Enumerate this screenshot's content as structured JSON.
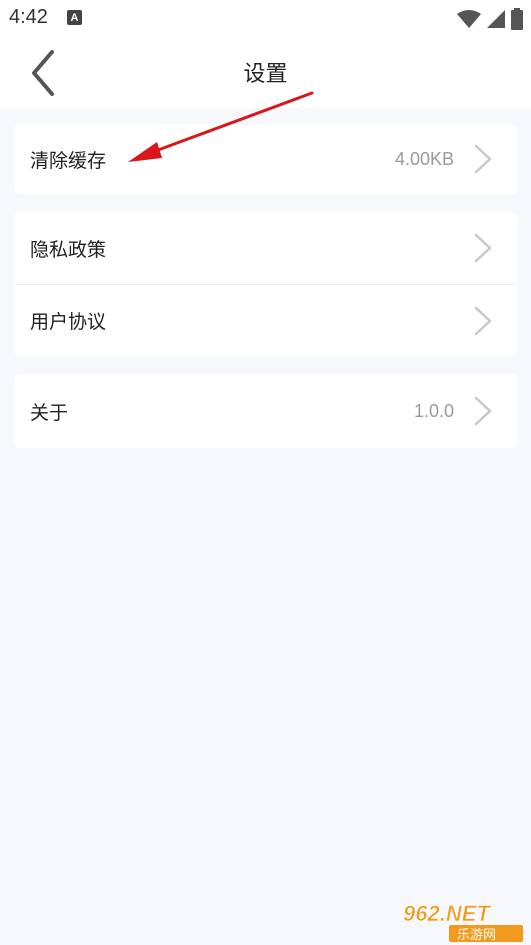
{
  "status_bar": {
    "time": "4:42",
    "notification_icon": "A"
  },
  "header": {
    "title": "设置"
  },
  "settings": {
    "clear_cache": {
      "label": "清除缓存",
      "value": "4.00KB"
    },
    "privacy_policy": {
      "label": "隐私政策"
    },
    "user_agreement": {
      "label": "用户协议"
    },
    "about": {
      "label": "关于",
      "value": "1.0.0"
    }
  },
  "watermark": {
    "top_text": "962.NET",
    "bottom_text": "乐游网"
  },
  "colors": {
    "background": "#f7f8fc",
    "card": "#ffffff",
    "annotation_arrow": "#d9161c",
    "watermark_orange": "#f29a1d"
  },
  "icons": {
    "back": "chevron-left-icon",
    "row_arrow": "chevron-right-icon",
    "wifi": "wifi-icon",
    "signal": "signal-icon",
    "battery": "battery-icon"
  }
}
